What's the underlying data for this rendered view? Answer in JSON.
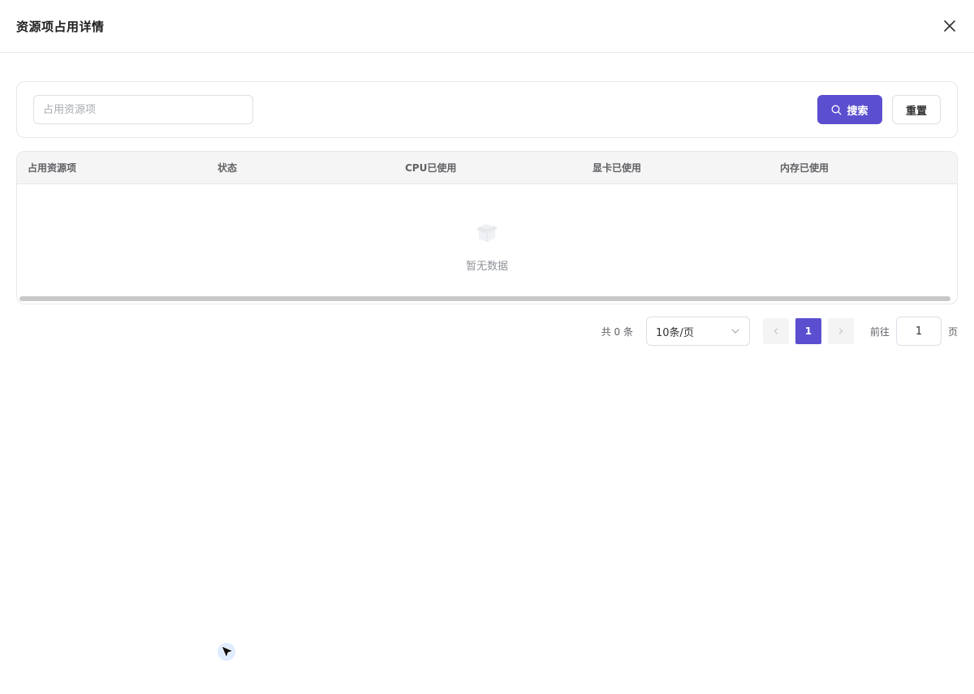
{
  "dialog": {
    "title": "资源项占用详情",
    "close_icon": "close-icon"
  },
  "search": {
    "placeholder": "占用资源项",
    "value": "",
    "search_label": "搜索",
    "reset_label": "重置",
    "search_icon": "search-icon"
  },
  "table": {
    "columns": [
      "占用资源项",
      "状态",
      "CPU已使用",
      "显卡已使用",
      "内存已使用"
    ],
    "rows": [],
    "empty_text": "暂无数据"
  },
  "pagination": {
    "total_text": "共 0 条",
    "page_size": "10条/页",
    "current_page": "1",
    "goto_label": "前往",
    "goto_value": "1",
    "page_unit": "页"
  },
  "colors": {
    "accent": "#5b4fcf",
    "border": "#dcdfe6",
    "header_bg": "#f5f5f5"
  }
}
